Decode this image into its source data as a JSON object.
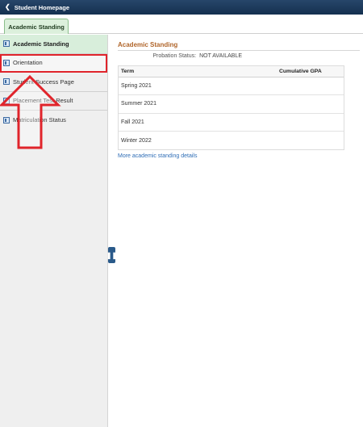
{
  "topbar": {
    "back_label": "Student Homepage",
    "back_icon": "chevron-left-icon"
  },
  "tabs": [
    {
      "label": "Academic Standing",
      "selected": true
    }
  ],
  "sidebar": {
    "items": [
      {
        "label": "Academic Standing",
        "icon": "page-icon",
        "active": true
      },
      {
        "label": "Orientation",
        "icon": "page-icon",
        "highlighted": true
      },
      {
        "label": "Student Success Page",
        "icon": "page-icon"
      },
      {
        "label": "Placement Test Result",
        "icon": "page-icon"
      },
      {
        "label": "Matriculation Status",
        "icon": "page-icon"
      }
    ]
  },
  "main": {
    "title": "Academic Standing",
    "probation_label": "Probation Status:",
    "probation_value": "NOT AVAILABLE",
    "table": {
      "columns": [
        "Term",
        "Cumulative GPA"
      ],
      "rows": [
        {
          "term": "Spring 2021",
          "gpa": ""
        },
        {
          "term": "Summer 2021",
          "gpa": ""
        },
        {
          "term": "Fall 2021",
          "gpa": ""
        },
        {
          "term": "Winter 2022",
          "gpa": ""
        }
      ]
    },
    "more_link": "More academic standing details"
  },
  "colors": {
    "topbar": "#1c3a5e",
    "active_tab": "#dcf0dc",
    "title_accent": "#b0652a",
    "annotation_red": "#e0242b",
    "link": "#2e6db6"
  }
}
